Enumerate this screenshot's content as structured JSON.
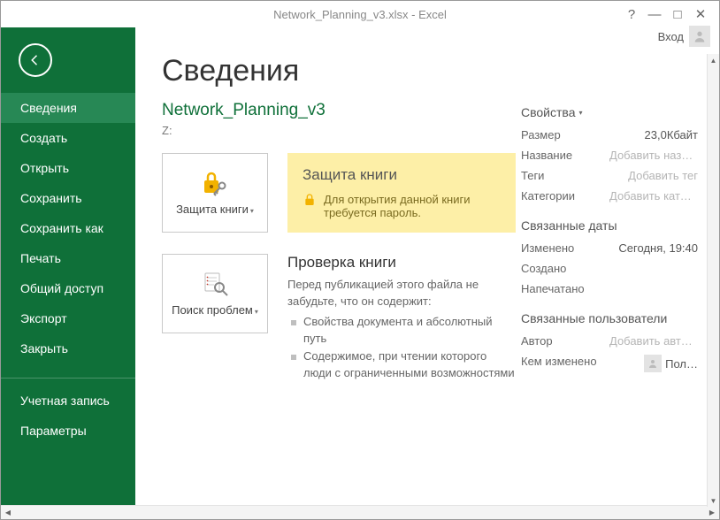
{
  "titlebar": {
    "title": "Network_Planning_v3.xlsx - Excel",
    "signin": "Вход"
  },
  "sidebar": {
    "items": [
      {
        "label": "Сведения",
        "active": true
      },
      {
        "label": "Создать"
      },
      {
        "label": "Открыть"
      },
      {
        "label": "Сохранить"
      },
      {
        "label": "Сохранить как"
      },
      {
        "label": "Печать"
      },
      {
        "label": "Общий доступ"
      },
      {
        "label": "Экспорт"
      },
      {
        "label": "Закрыть"
      }
    ],
    "footer": [
      {
        "label": "Учетная запись"
      },
      {
        "label": "Параметры"
      }
    ]
  },
  "page": {
    "title": "Сведения",
    "docname": "Network_Planning_v3",
    "loc": "Z:"
  },
  "protect": {
    "button": "Защита книги",
    "heading": "Защита книги",
    "desc": "Для открытия данной книги требуется пароль."
  },
  "inspect": {
    "button": "Поиск проблем",
    "heading": "Проверка книги",
    "intro": "Перед публикацией этого файла не забудьте, что он содержит:",
    "items": [
      "Свойства документа и абсолютный путь",
      "Содержимое, при чтении которого люди с ограниченными возможностями"
    ]
  },
  "props": {
    "heading": "Свойства",
    "rows": [
      {
        "k": "Размер",
        "v": "23,0Кбайт"
      },
      {
        "k": "Название",
        "v": "Добавить название",
        "ph": true
      },
      {
        "k": "Теги",
        "v": "Добавить тег",
        "ph": true
      },
      {
        "k": "Категории",
        "v": "Добавить категорию",
        "ph": true
      }
    ],
    "dates_heading": "Связанные даты",
    "dates": [
      {
        "k": "Изменено",
        "v": "Сегодня, 19:40"
      },
      {
        "k": "Создано",
        "v": ""
      },
      {
        "k": "Напечатано",
        "v": ""
      }
    ],
    "people_heading": "Связанные пользователи",
    "people": [
      {
        "k": "Автор",
        "v": "Добавить автора",
        "ph": true
      },
      {
        "k": "Кем изменено",
        "v": "Пол…"
      }
    ]
  }
}
